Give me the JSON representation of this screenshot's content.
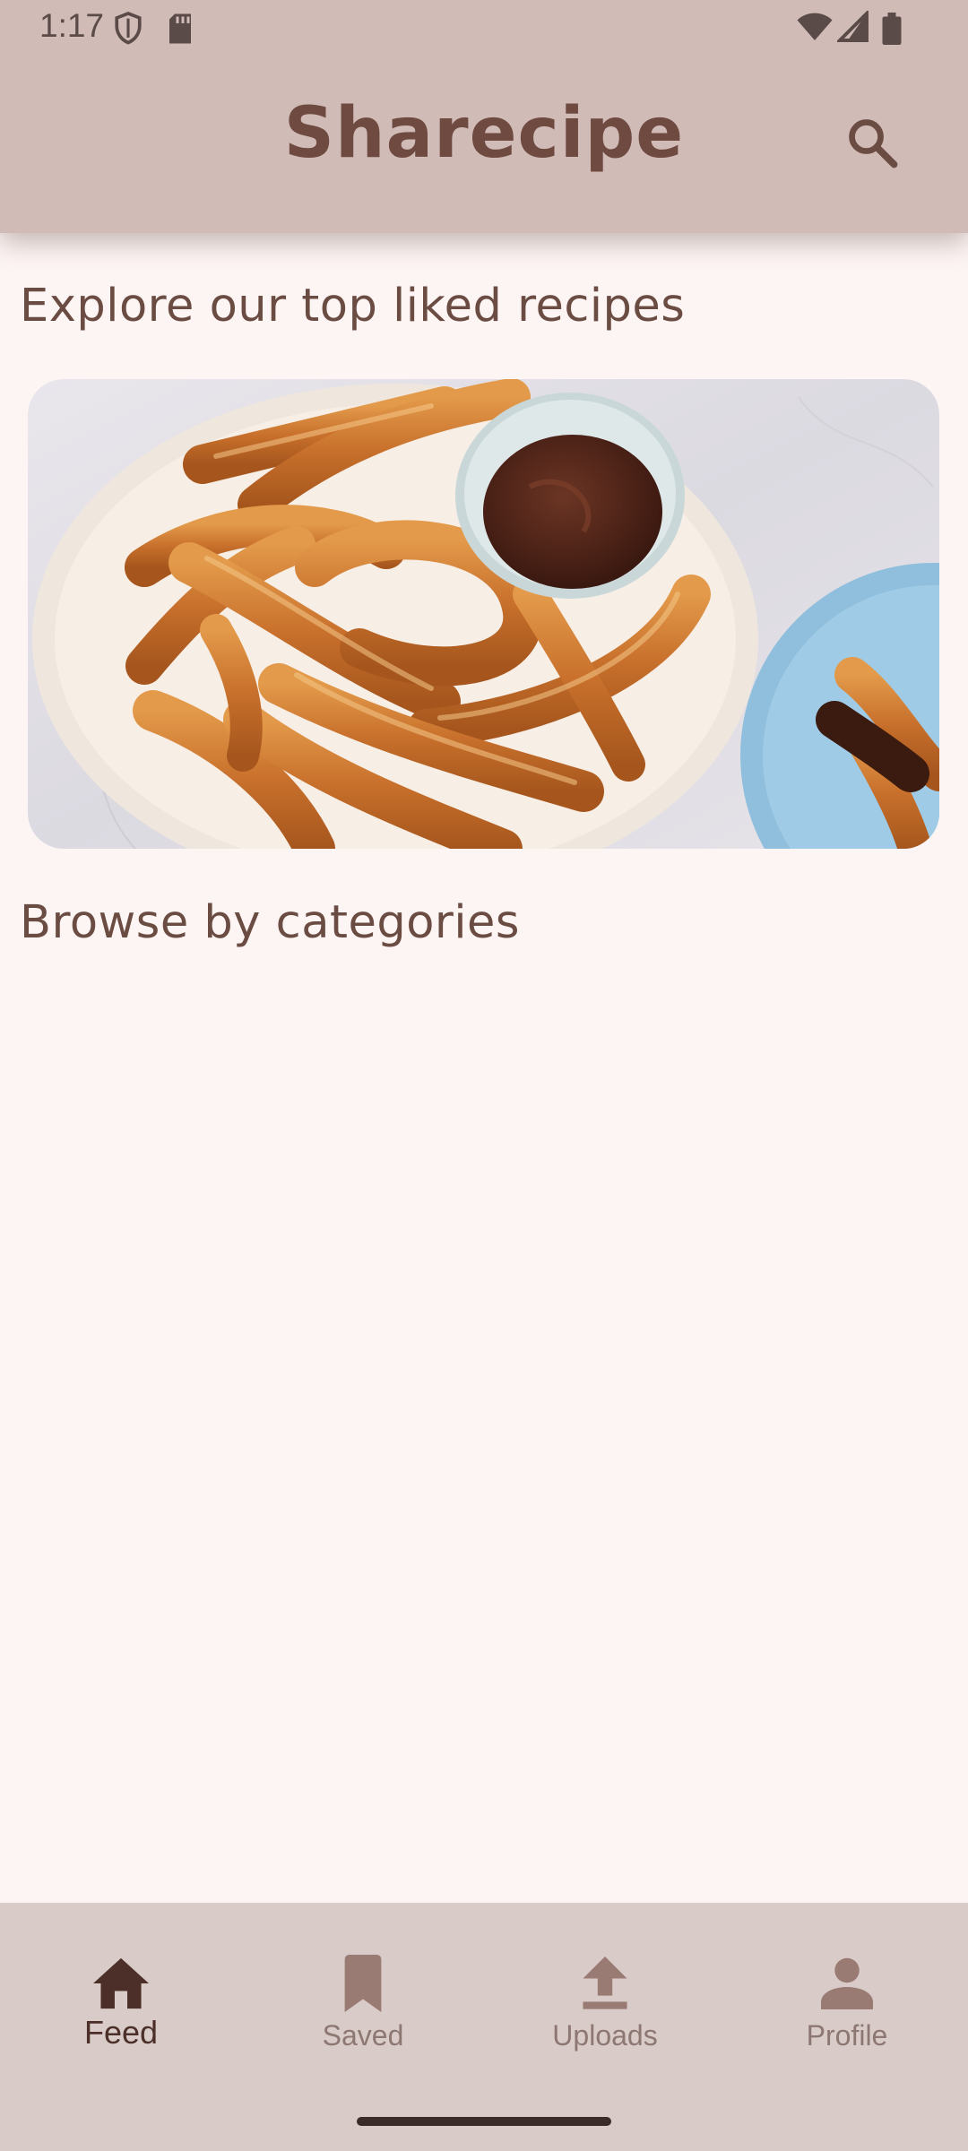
{
  "status_bar": {
    "time": "1:17",
    "icons": [
      "shield-icon",
      "sd-card-icon",
      "wifi-icon",
      "signal-icon",
      "battery-icon"
    ]
  },
  "app_bar": {
    "title": "Sharecipe",
    "search_icon": "search-icon"
  },
  "main": {
    "top_liked_heading": "Explore our top liked recipes",
    "featured_image": "churros-with-chocolate-dip",
    "categories_heading": "Browse by categories"
  },
  "bottom_nav": {
    "items": [
      {
        "label": "Feed",
        "icon": "home-icon",
        "active": true
      },
      {
        "label": "Saved",
        "icon": "bookmark-icon",
        "active": false
      },
      {
        "label": "Uploads",
        "icon": "upload-icon",
        "active": false
      },
      {
        "label": "Profile",
        "icon": "person-icon",
        "active": false
      }
    ]
  },
  "colors": {
    "app_bar_bg": "#d1bbb7",
    "page_bg": "#fdf5f4",
    "bottom_nav_bg": "#d9cbc8",
    "brand_text": "#6e4a40",
    "active_nav": "#4b2f28",
    "inactive_nav": "#8d7773"
  }
}
